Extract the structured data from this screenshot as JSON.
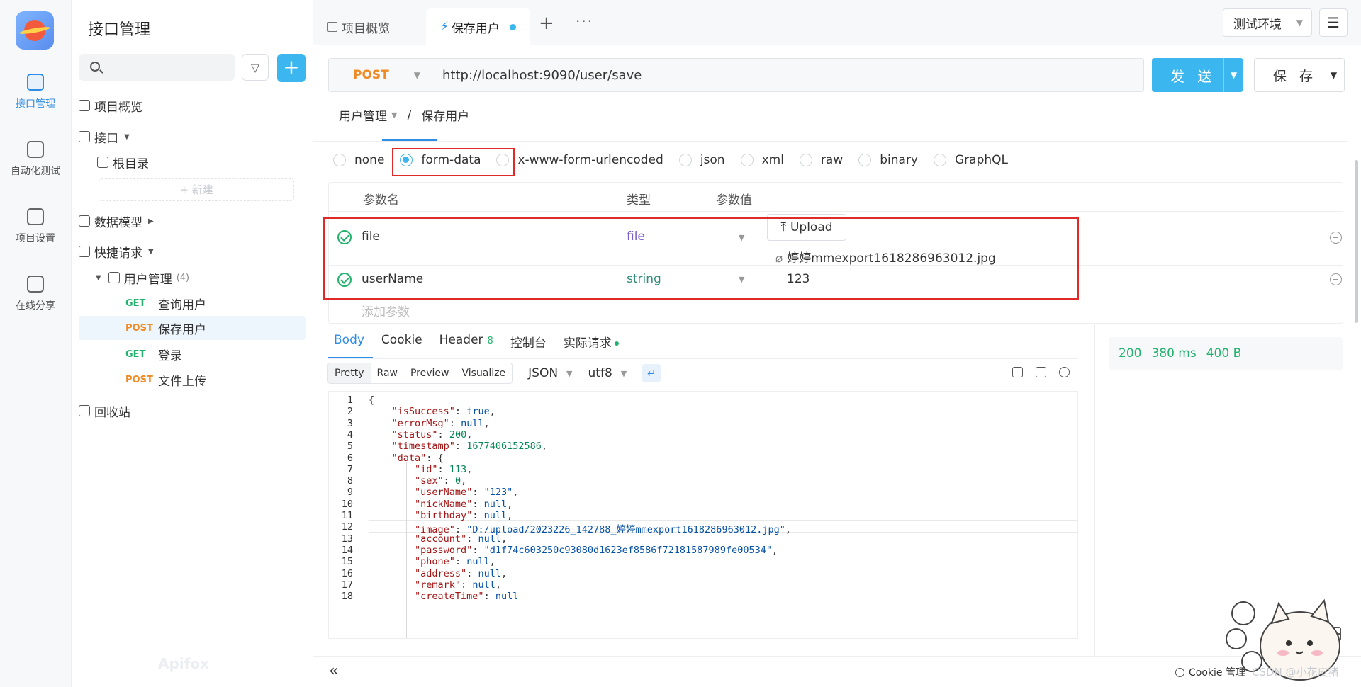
{
  "rail": {
    "items": [
      {
        "label": "接口管理",
        "icon": "api-icon",
        "active": true
      },
      {
        "label": "自动化测试",
        "icon": "automation-icon",
        "active": false
      },
      {
        "label": "项目设置",
        "icon": "project-settings-icon",
        "active": false
      },
      {
        "label": "在线分享",
        "icon": "share-icon",
        "active": false
      }
    ]
  },
  "sidebar": {
    "title": "接口管理",
    "search_placeholder": "",
    "add_label": "+",
    "new_label": "+ 新建",
    "overview": "项目概览",
    "interfaces": "接口",
    "root_dir": "根目录",
    "data_model": "数据模型",
    "quick_request": "快捷请求",
    "group": {
      "name": "用户管理",
      "count": "(4)"
    },
    "requests": [
      {
        "method": "GET",
        "name": "查询用户"
      },
      {
        "method": "POST",
        "name": "保存用户"
      },
      {
        "method": "GET",
        "name": "登录"
      },
      {
        "method": "POST",
        "name": "文件上传"
      }
    ],
    "trash": "回收站",
    "watermark": "Apifox"
  },
  "tabs": {
    "overview": "项目概览",
    "active": "保存用户",
    "add": "+",
    "more": "···"
  },
  "env": {
    "value": "测试环境"
  },
  "request": {
    "method": "POST",
    "url": "http://localhost:9090/user/save",
    "send_label": "发 送",
    "save_label": "保 存"
  },
  "breadcrumb": {
    "group": "用户管理",
    "sep": "/",
    "name": "保存用户"
  },
  "body_types": [
    "none",
    "form-data",
    "x-www-form-urlencoded",
    "json",
    "xml",
    "raw",
    "binary",
    "GraphQL"
  ],
  "body_selected": "form-data",
  "params": {
    "headers": {
      "name": "参数名",
      "type": "类型",
      "value": "参数值"
    },
    "rows": [
      {
        "name": "file",
        "type": "file",
        "upload_label": "Upload",
        "value": "婷婷mmexport1618286963012.jpg"
      },
      {
        "name": "userName",
        "type": "string",
        "value": "123"
      }
    ],
    "add_placeholder": "添加参数"
  },
  "response": {
    "tabs": [
      {
        "label": "Body",
        "active": true
      },
      {
        "label": "Cookie"
      },
      {
        "label": "Header",
        "badge": "8"
      },
      {
        "label": "控制台"
      },
      {
        "label": "实际请求",
        "dot": true
      }
    ],
    "formats": [
      "Pretty",
      "Raw",
      "Preview",
      "Visualize"
    ],
    "format_selected": "Pretty",
    "lang": "JSON",
    "encoding": "utf8",
    "status_code": "200",
    "time": "380 ms",
    "size": "400 B",
    "lines": [
      "{",
      "    \"isSuccess\": true,",
      "    \"errorMsg\": null,",
      "    \"status\": 200,",
      "    \"timestamp\": 1677406152586,",
      "    \"data\": {",
      "        \"id\": 113,",
      "        \"sex\": 0,",
      "        \"userName\": \"123\",",
      "        \"nickName\": null,",
      "        \"birthday\": null,",
      "        \"image\": \"D:/upload/2023226_142788_婷婷mmexport1618286963012.jpg\",",
      "        \"account\": null,",
      "        \"password\": \"d1f74c603250c93080d1623ef8586f72181587989fe00534\",",
      "        \"phone\": null,",
      "        \"address\": null,",
      "        \"remark\": null,",
      "        \"createTime\": null"
    ]
  },
  "footer": {
    "collapse": "«",
    "cookie_label": "Cookie 管理",
    "csdn": "CSDN @小花皮猪"
  },
  "colors": {
    "accent": "#3cb6ee",
    "post": "#f08a24",
    "get": "#23b26d",
    "highlight": "#e02a2a"
  }
}
